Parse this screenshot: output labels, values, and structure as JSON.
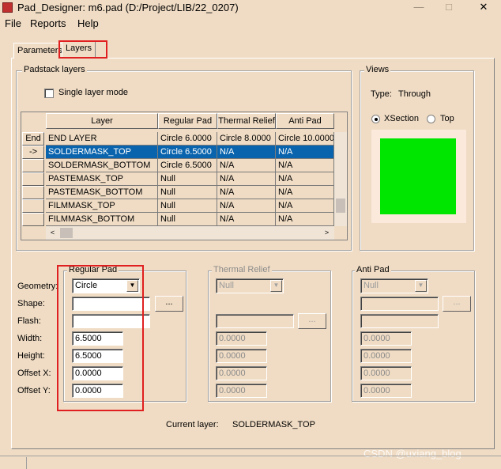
{
  "window": {
    "title": "Pad_Designer: m6.pad (D:/Project/LIB/22_0207)",
    "minimize": "—",
    "maximize": "□",
    "close": "✕"
  },
  "menu": [
    "File",
    "Reports",
    "Help"
  ],
  "tabs": {
    "parameters": "Parameters",
    "layers": "Layers"
  },
  "padstack": {
    "group_label": "Padstack layers",
    "single_layer_mode": "Single layer mode",
    "columns": [
      "Layer",
      "Regular Pad",
      "Thermal Relief",
      "Anti Pad"
    ],
    "rows": [
      {
        "header": "End",
        "layer": "END LAYER",
        "regular": "Circle 6.0000",
        "thermal": "Circle 8.0000",
        "anti": "Circle 10.0000"
      },
      {
        "header": "->",
        "layer": "SOLDERMASK_TOP",
        "regular": "Circle 6.5000",
        "thermal": "N/A",
        "anti": "N/A"
      },
      {
        "header": "",
        "layer": "SOLDERMASK_BOTTOM",
        "regular": "Circle 6.5000",
        "thermal": "N/A",
        "anti": "N/A"
      },
      {
        "header": "",
        "layer": "PASTEMASK_TOP",
        "regular": "Null",
        "thermal": "N/A",
        "anti": "N/A"
      },
      {
        "header": "",
        "layer": "PASTEMASK_BOTTOM",
        "regular": "Null",
        "thermal": "N/A",
        "anti": "N/A"
      },
      {
        "header": "",
        "layer": "FILMMASK_TOP",
        "regular": "Null",
        "thermal": "N/A",
        "anti": "N/A"
      },
      {
        "header": "",
        "layer": "FILMMASK_BOTTOM",
        "regular": "Null",
        "thermal": "N/A",
        "anti": "N/A"
      }
    ],
    "selected_row": 1,
    "scroll_left": "<",
    "scroll_right": ">"
  },
  "views": {
    "group_label": "Views",
    "type_label": "Type:",
    "type_value": "Through",
    "xsection": "XSection",
    "top": "Top",
    "preview_color": "#00e600"
  },
  "field_labels": {
    "geometry": "Geometry:",
    "shape": "Shape:",
    "flash": "Flash:",
    "width": "Width:",
    "height": "Height:",
    "offset_x": "Offset X:",
    "offset_y": "Offset Y:"
  },
  "regular_pad": {
    "label": "Regular Pad",
    "geometry": "Circle",
    "shape": "",
    "flash": "",
    "width": "6.5000",
    "height": "6.5000",
    "offset_x": "0.0000",
    "offset_y": "0.0000",
    "browse": "..."
  },
  "thermal_relief": {
    "label": "Thermal Relief",
    "geometry": "Null",
    "width": "0.0000",
    "height": "0.0000",
    "offset_x": "0.0000",
    "offset_y": "0.0000",
    "browse": "..."
  },
  "anti_pad": {
    "label": "Anti Pad",
    "geometry": "Null",
    "width": "0.0000",
    "height": "0.0000",
    "offset_x": "0.0000",
    "offset_y": "0.0000",
    "browse": "..."
  },
  "current_layer": {
    "label": "Current layer:",
    "value": "SOLDERMASK_TOP"
  },
  "watermark": "CSDN @uxiang_blog",
  "colors": {
    "background": "#f0dcc4",
    "selection": "#0a64ad",
    "highlight_box": "#e02020"
  }
}
